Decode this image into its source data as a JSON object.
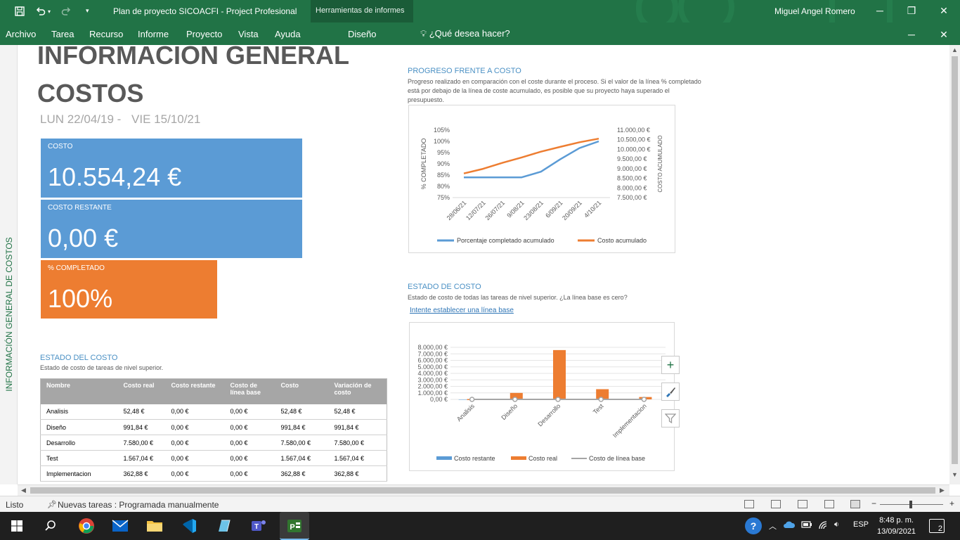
{
  "titlebar": {
    "doc_title": "Plan de proyecto SICOACFI  -  Project Profesional",
    "context_tab": "Herramientas de informes",
    "user": "Miguel Angel Romero"
  },
  "menu": {
    "items": [
      "Archivo",
      "Tarea",
      "Recurso",
      "Informe",
      "Proyecto",
      "Vista",
      "Ayuda",
      "Diseño"
    ],
    "help": "¿Qué desea hacer?"
  },
  "sidebar": {
    "label": "INFORMACIÓN GENERAL DE COSTOS"
  },
  "report": {
    "title_line1": "INFORMACIÓN GENERAL",
    "title_line2": "COSTOS",
    "date_start": "LUN 22/04/19 -",
    "date_end": "VIE 15/10/21",
    "cards": {
      "cost_label": "COSTO",
      "cost_value": "10.554,24 €",
      "remaining_label": "COSTO RESTANTE",
      "remaining_value": "0,00 €",
      "pct_label": "% COMPLETADO",
      "pct_value": "100%"
    }
  },
  "cost_status": {
    "title": "ESTADO DEL COSTO",
    "desc": "Estado de costo de tareas de nivel superior.",
    "headers": [
      "Nombre",
      "Costo real",
      "Costo restante",
      "Costo de línea base",
      "Costo",
      "Variación de costo"
    ],
    "rows": [
      [
        " Analisis",
        "52,48 €",
        "0,00 €",
        "0,00 €",
        "52,48 €",
        "52,48 €"
      ],
      [
        "Diseño",
        "991,84 €",
        "0,00 €",
        "0,00 €",
        "991,84 €",
        "991,84 €"
      ],
      [
        "Desarrollo",
        "7.580,00 €",
        "0,00 €",
        "0,00 €",
        "7.580,00 €",
        "7.580,00 €"
      ],
      [
        "Test",
        "1.567,04 €",
        "0,00 €",
        "0,00 €",
        "1.567,04 €",
        "1.567,04 €"
      ],
      [
        "Implementacion",
        "362,88 €",
        "0,00 €",
        "0,00 €",
        "362,88 €",
        "362,88 €"
      ]
    ]
  },
  "progress_section": {
    "title": "PROGRESO FRENTE A COSTO",
    "desc": "Progreso realizado en comparación con el coste durante el proceso. Si el valor de la línea % completado está por debajo de la línea de coste acumulado, es posible que su proyecto haya superado el presupuesto."
  },
  "state_section": {
    "title": "ESTADO DE COSTO",
    "desc": "Estado de costo de todas las tareas de nivel superior. ¿La línea base es cero?",
    "link": "Intente establecer una línea base"
  },
  "chart_data": [
    {
      "type": "line",
      "title": "",
      "ylabel": "% COMPLETADO",
      "y2label": "COSTO ACUMULADO",
      "x": [
        "28/06/21",
        "12/07/21",
        "26/07/21",
        "9/08/21",
        "23/08/21",
        "6/09/21",
        "20/09/21",
        "4/10/21"
      ],
      "ylim": [
        75,
        105
      ],
      "yticks": [
        "75%",
        "80%",
        "85%",
        "90%",
        "95%",
        "100%",
        "105%"
      ],
      "y2lim": [
        7500,
        11000
      ],
      "y2ticks": [
        "7.500,00 €",
        "8.000,00 €",
        "8.500,00 €",
        "9.000,00 €",
        "9.500,00 €",
        "10.000,00 €",
        "10.500,00 €",
        "11.000,00 €"
      ],
      "legend_position": "bottom",
      "series": [
        {
          "name": "Porcentaje completado acumulado",
          "axis": "left",
          "color": "#5b9bd5",
          "values": [
            84,
            84,
            84,
            84,
            86.5,
            92,
            97,
            100
          ]
        },
        {
          "name": "Costo acumulado",
          "axis": "right",
          "color": "#ed7d31",
          "values": [
            8750,
            8990,
            9300,
            9580,
            9880,
            10130,
            10370,
            10554
          ]
        }
      ]
    },
    {
      "type": "bar",
      "title": "",
      "categories": [
        "Analisis",
        "Diseño",
        "Desarrollo",
        "Test",
        "Implementacion"
      ],
      "ylim": [
        0,
        8000
      ],
      "yticks": [
        "0,00 €",
        "1.000,00 €",
        "2.000,00 €",
        "3.000,00 €",
        "4.000,00 €",
        "5.000,00 €",
        "6.000,00 €",
        "7.000,00 €",
        "8.000,00 €"
      ],
      "legend_position": "bottom",
      "series": [
        {
          "name": "Costo restante",
          "kind": "bar",
          "color": "#5b9bd5",
          "values": [
            0,
            0,
            0,
            0,
            0
          ]
        },
        {
          "name": "Costo real",
          "kind": "bar",
          "color": "#ed7d31",
          "values": [
            52.48,
            991.84,
            7580.0,
            1567.04,
            362.88
          ]
        },
        {
          "name": "Costo de línea base",
          "kind": "line",
          "color": "#a5a5a5",
          "values": [
            0,
            0,
            0,
            0,
            0
          ]
        }
      ]
    }
  ],
  "chart_tools": {
    "add": "+",
    "style": "brush",
    "filter": "filter"
  },
  "status": {
    "ready": "Listo",
    "new_tasks": "Nuevas tareas : Programada manualmente"
  },
  "taskbar": {
    "lang": "ESP",
    "time": "8:48 p. m.",
    "date": "13/09/2021",
    "notifications": "2"
  }
}
